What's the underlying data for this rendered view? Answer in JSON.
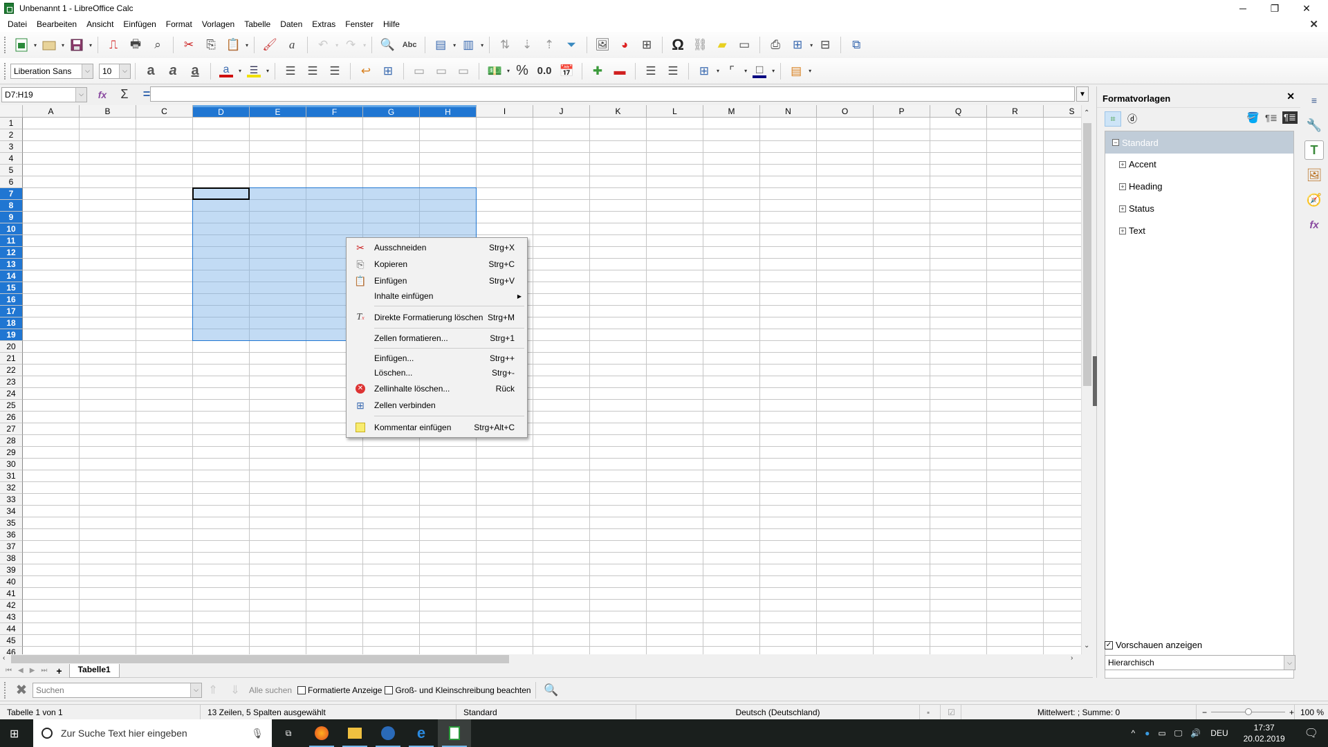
{
  "window": {
    "title": "Unbenannt 1 - LibreOffice Calc",
    "minimize": "─",
    "restore": "❐",
    "close": "✕"
  },
  "menu": [
    "Datei",
    "Bearbeiten",
    "Ansicht",
    "Einfügen",
    "Format",
    "Vorlagen",
    "Tabelle",
    "Daten",
    "Extras",
    "Fenster",
    "Hilfe"
  ],
  "menu_close": "✕",
  "formatting": {
    "font_name": "Liberation Sans",
    "font_size": "10",
    "percent": "%",
    "number_format": "0.0"
  },
  "formula_bar": {
    "name_box": "D7:H19",
    "function_wizard": "fx",
    "sum": "Σ",
    "equals": "=",
    "input_value": ""
  },
  "grid": {
    "columns": [
      "A",
      "B",
      "C",
      "D",
      "E",
      "F",
      "G",
      "H",
      "I",
      "J",
      "K",
      "L",
      "M",
      "N",
      "O",
      "P",
      "Q",
      "R",
      "S"
    ],
    "selected_columns": [
      "D",
      "E",
      "F",
      "G",
      "H"
    ],
    "row_count": 46,
    "selected_rows": [
      7,
      8,
      9,
      10,
      11,
      12,
      13,
      14,
      15,
      16,
      17,
      18,
      19
    ]
  },
  "sheet_tabs": {
    "add": "+",
    "tabs": [
      "Tabelle1"
    ],
    "active": "Tabelle1"
  },
  "find_bar": {
    "search_placeholder": "Suchen",
    "find_all": "Alle suchen",
    "formatted_display": "Formatierte Anzeige",
    "match_case": "Groß- und Kleinschreibung beachten",
    "formatted_checked": false,
    "match_case_checked": false
  },
  "status_bar": {
    "sheet": "Tabelle 1 von 1",
    "selection": "13 Zeilen, 5 Spalten ausgewählt",
    "style": "Standard",
    "language": "Deutsch (Deutschland)",
    "sum": "Mittelwert: ; Summe: 0",
    "zoom_minus": "−",
    "zoom_plus": "+",
    "zoom": "100 %",
    "zoom_percent": 100
  },
  "sidebar": {
    "title": "Formatvorlagen",
    "close": "✕",
    "tree": [
      {
        "label": "Standard",
        "expanded": true,
        "selected": true
      },
      {
        "label": "Accent",
        "expanded": false
      },
      {
        "label": "Heading",
        "expanded": false
      },
      {
        "label": "Status",
        "expanded": false
      },
      {
        "label": "Text",
        "expanded": false
      }
    ],
    "show_previews": "Vorschauen anzeigen",
    "show_previews_checked": true,
    "filter": "Hierarchisch"
  },
  "context_menu": {
    "items": [
      {
        "label": "Ausschneiden",
        "shortcut": "Strg+X",
        "icon": "scissors-icon"
      },
      {
        "label": "Kopieren",
        "shortcut": "Strg+C",
        "icon": "copy-icon"
      },
      {
        "label": "Einfügen",
        "shortcut": "Strg+V",
        "icon": "paste-icon"
      },
      {
        "label": "Inhalte einfügen",
        "shortcut": "",
        "submenu": true
      },
      {
        "label": "Direkte Formatierung löschen",
        "shortcut": "Strg+M",
        "icon": "clear-formatting-icon"
      },
      {
        "label": "Zellen formatieren...",
        "shortcut": "Strg+1"
      },
      {
        "label": "Einfügen...",
        "shortcut": "Strg++"
      },
      {
        "label": "Löschen...",
        "shortcut": "Strg+-"
      },
      {
        "label": "Zellinhalte löschen...",
        "shortcut": "Rück",
        "icon": "delete-contents-icon"
      },
      {
        "label": "Zellen verbinden",
        "shortcut": "",
        "icon": "merge-cells-icon"
      },
      {
        "label": "Kommentar einfügen",
        "shortcut": "Strg+Alt+C",
        "icon": "comment-icon"
      }
    ]
  },
  "taskbar": {
    "search_placeholder": "Zur Suche Text hier eingeben",
    "language": "DEU",
    "time": "17:37",
    "date": "20.02.2019"
  }
}
